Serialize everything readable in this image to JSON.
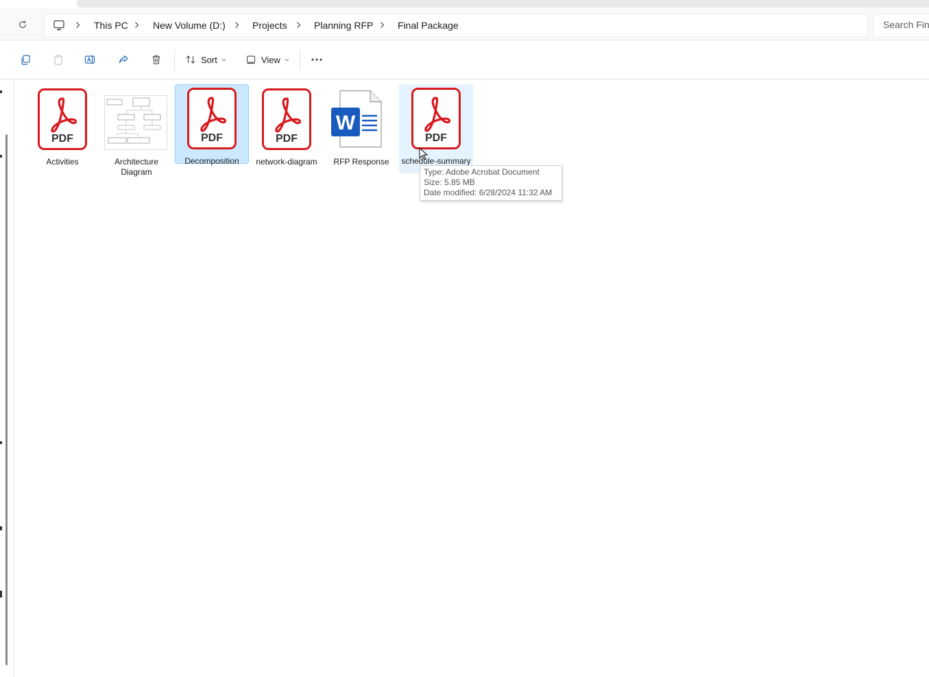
{
  "breadcrumb": [
    "This PC",
    "New Volume (D:)",
    "Projects",
    "Planning RFP",
    "Final Package"
  ],
  "search": {
    "placeholder": "Search Final Package"
  },
  "toolbar": {
    "sort_label": "Sort",
    "view_label": "View"
  },
  "files": [
    {
      "name": "Activities",
      "type": "pdf",
      "icon_text": "PDF"
    },
    {
      "name": "Architecture Diagram",
      "type": "image"
    },
    {
      "name": "Decomposition",
      "type": "pdf",
      "icon_text": "PDF",
      "state": "selected"
    },
    {
      "name": "network-diagram",
      "type": "pdf",
      "icon_text": "PDF"
    },
    {
      "name": "RFP Response",
      "type": "word",
      "icon_text": "W"
    },
    {
      "name": "schedule-summary",
      "type": "pdf",
      "icon_text": "PDF",
      "state": "hovered"
    }
  ],
  "tooltip": {
    "type_line": "Type: Adobe Acrobat Document",
    "size_line": "Size: 5.85 MB",
    "date_line": "Date modified: 6/28/2024 11:32 AM"
  },
  "colors": {
    "pdf_red": "#d7191f",
    "word_blue": "#185abd",
    "selection": "#cce8ff",
    "hover": "#e5f3ff"
  }
}
